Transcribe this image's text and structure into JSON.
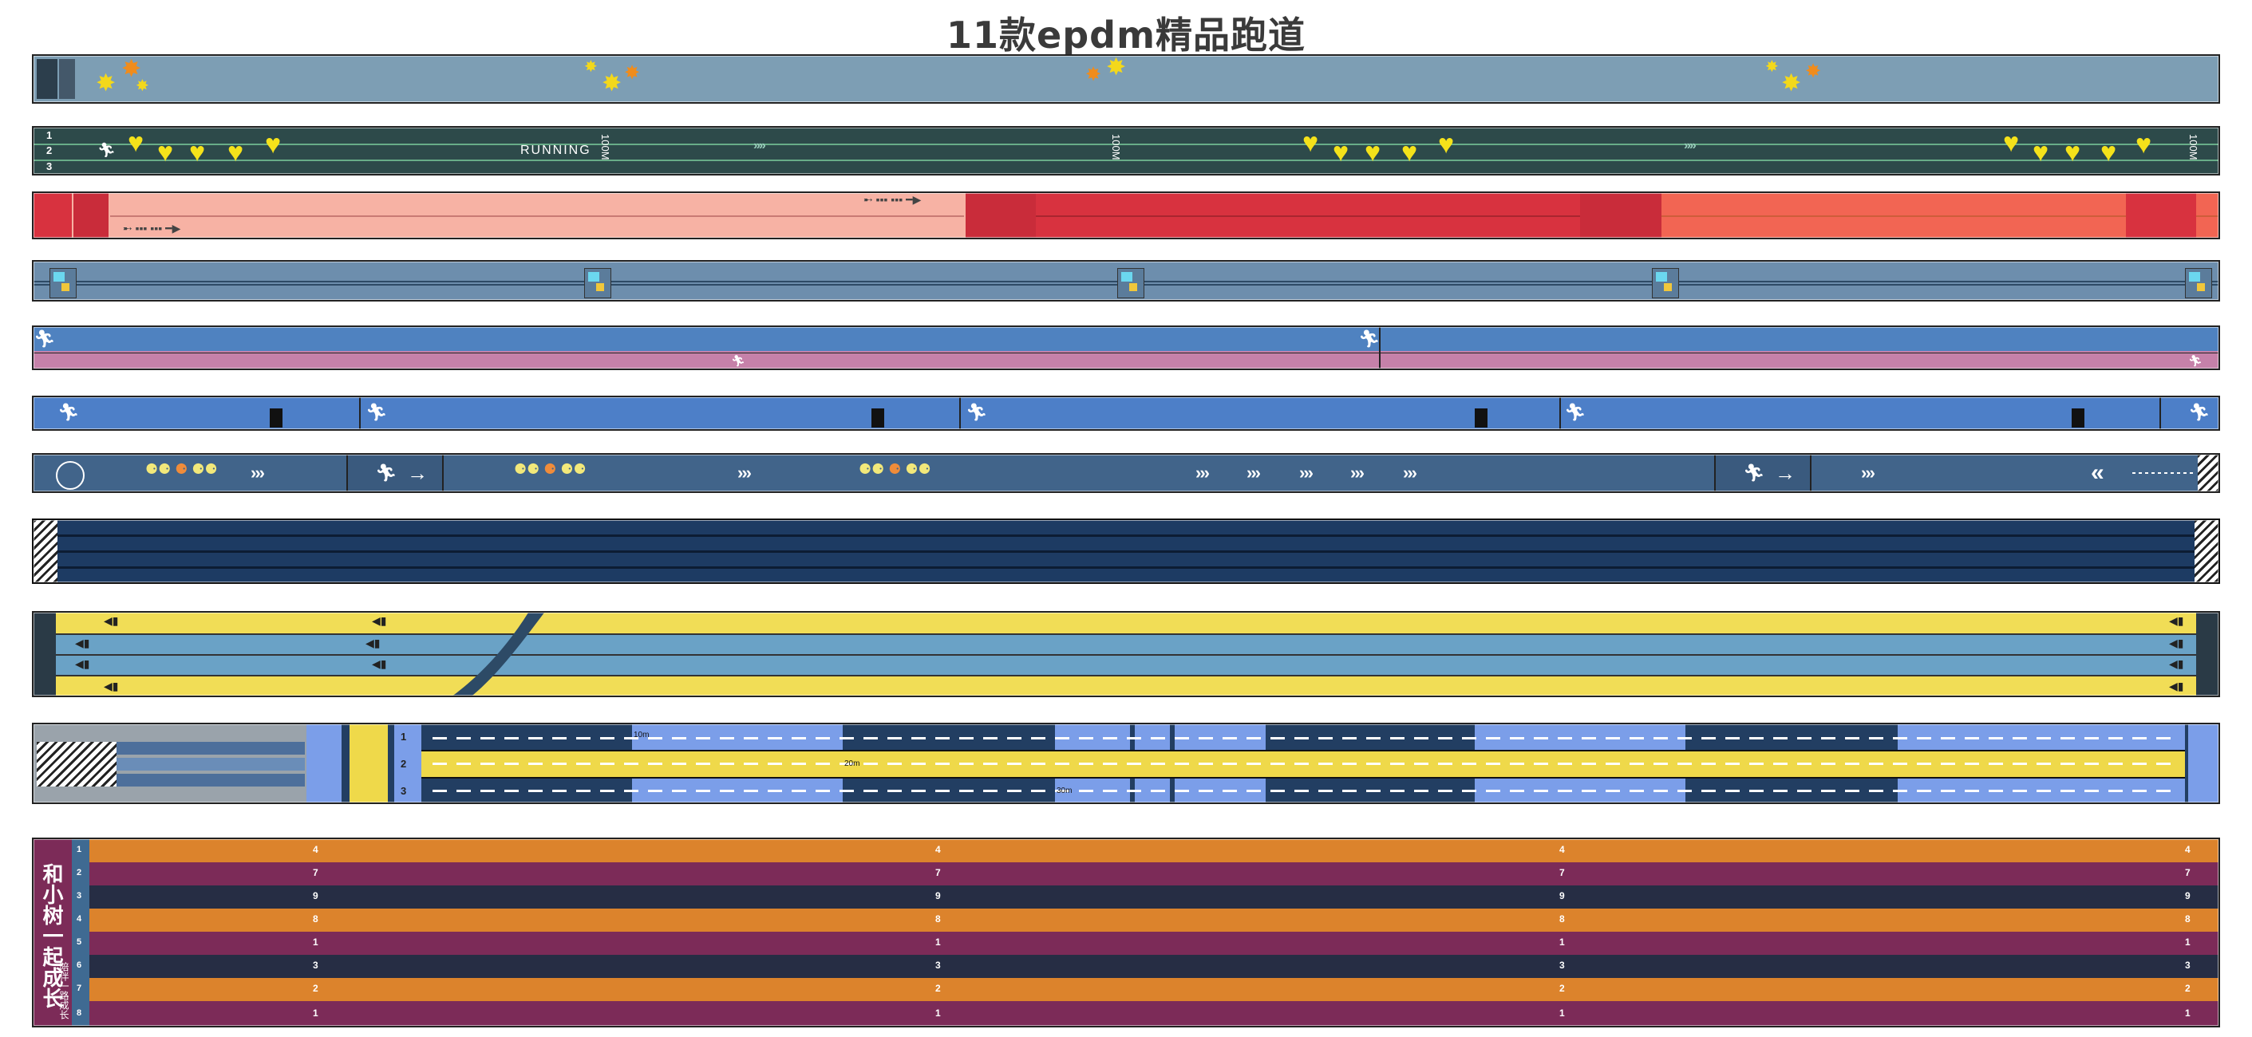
{
  "title": "11款epdm精品跑道",
  "colors": {
    "t1": "#7d9eb4",
    "t2": "#2d4a4a",
    "t3_pink": "#f7b2a4",
    "t3_red": "#d8323f",
    "t3_coral": "#f26553",
    "t4": "#6d8ead",
    "t5_blue": "#4f82c0",
    "t5_mauve": "#c681a9",
    "t6": "#4d7fc8",
    "t7": "#41648a",
    "t8": "#1d3b63",
    "t9_yellow": "#f1dd56",
    "t9_blue": "#6aa2c6",
    "t10_navy": "#223e62",
    "t10_light": "#7b9ee9",
    "t10_yellow": "#efd94a",
    "t11_orange": "#dc832c",
    "t11_purple": "#7c2b58",
    "t11_navy": "#262d44"
  },
  "track2": {
    "running_label": "RUNNING",
    "lane_numbers": [
      "1",
      "2",
      "3"
    ],
    "distance_marker": "100M"
  },
  "track10": {
    "lanes": [
      "1",
      "2",
      "3"
    ],
    "distance_labels": [
      "10m",
      "20m",
      "30m"
    ]
  },
  "track11": {
    "vertical_banner": "和小树一起成长",
    "vertical_banner_sub": "陪伴一路成长",
    "lane_numbers": [
      "1",
      "2",
      "3",
      "4",
      "5",
      "6",
      "7",
      "8"
    ],
    "lane_marks": [
      "4",
      "7",
      "9",
      "8",
      "1",
      "3",
      "2",
      "1"
    ]
  },
  "icons": [
    "maple-leaf-icon",
    "heart-icon",
    "runner-icon",
    "arrow-right-icon",
    "footprints-icon",
    "chevron-icon"
  ]
}
